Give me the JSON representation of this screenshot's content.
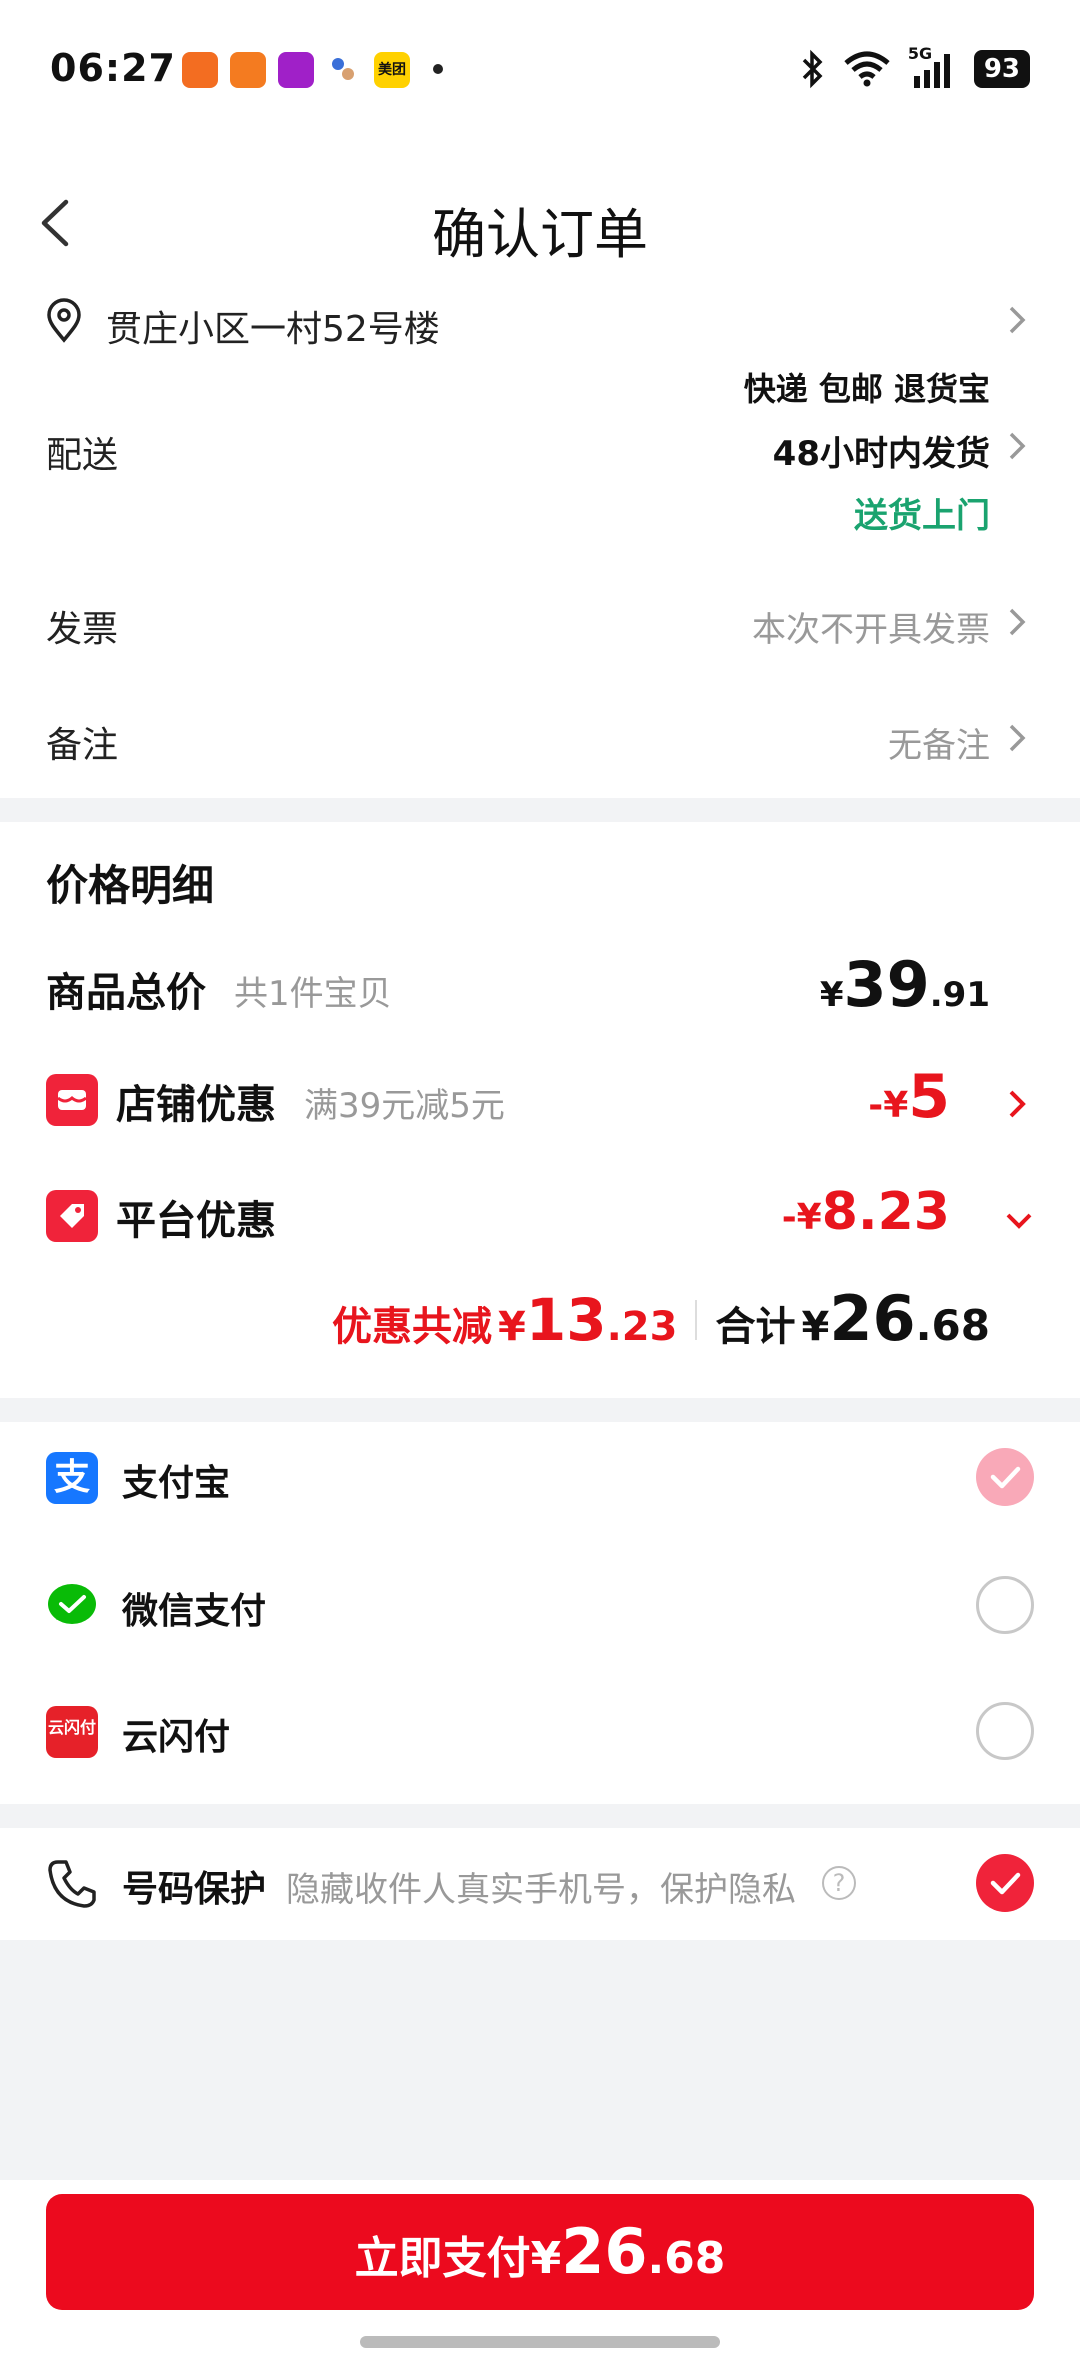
{
  "status_bar": {
    "time": "06:27",
    "network": "5G",
    "battery": "93"
  },
  "header": {
    "title": "确认订单"
  },
  "address": {
    "text": "贯庄小区一村52号楼"
  },
  "delivery": {
    "label": "配送",
    "line1": "快递 包邮 退货宝",
    "line2": "48小时内发货",
    "line3": "送货上门"
  },
  "invoice": {
    "label": "发票",
    "value": "本次不开具发票"
  },
  "remark": {
    "label": "备注",
    "value": "无备注"
  },
  "price_detail": {
    "title": "价格明细",
    "goods_total": {
      "label": "商品总价",
      "sub": "共1件宝贝",
      "currency": "¥",
      "int": "39",
      "dec": ".91"
    },
    "shop_discount": {
      "label": "店铺优惠",
      "sub": "满39元减5元",
      "prefix": "-¥",
      "value": "5"
    },
    "platform_discount": {
      "label": "平台优惠",
      "prefix": "-¥",
      "value": "8.23"
    },
    "summary": {
      "saved_label": "优惠共减",
      "saved_currency": "¥",
      "saved_int": "13",
      "saved_dec": ".23",
      "total_label": "合计",
      "total_currency": "¥",
      "total_int": "26",
      "total_dec": ".68"
    }
  },
  "payment": {
    "methods": [
      {
        "label": "支付宝",
        "icon": "alipay-icon",
        "selected": true
      },
      {
        "label": "微信支付",
        "icon": "wechat-pay-icon",
        "selected": false
      },
      {
        "label": "云闪付",
        "icon": "unionpay-icon",
        "selected": false
      }
    ]
  },
  "privacy": {
    "label": "号码保护",
    "desc": "隐藏收件人真实手机号，保护隐私",
    "enabled": true
  },
  "pay_button": {
    "label": "立即支付",
    "currency": "¥",
    "int": "26",
    "dec": ".68"
  },
  "colors": {
    "accent_red": "#ec0a1e",
    "green": "#1aa36f",
    "alipay_blue": "#1677ff",
    "wechat_green": "#09bb07"
  }
}
